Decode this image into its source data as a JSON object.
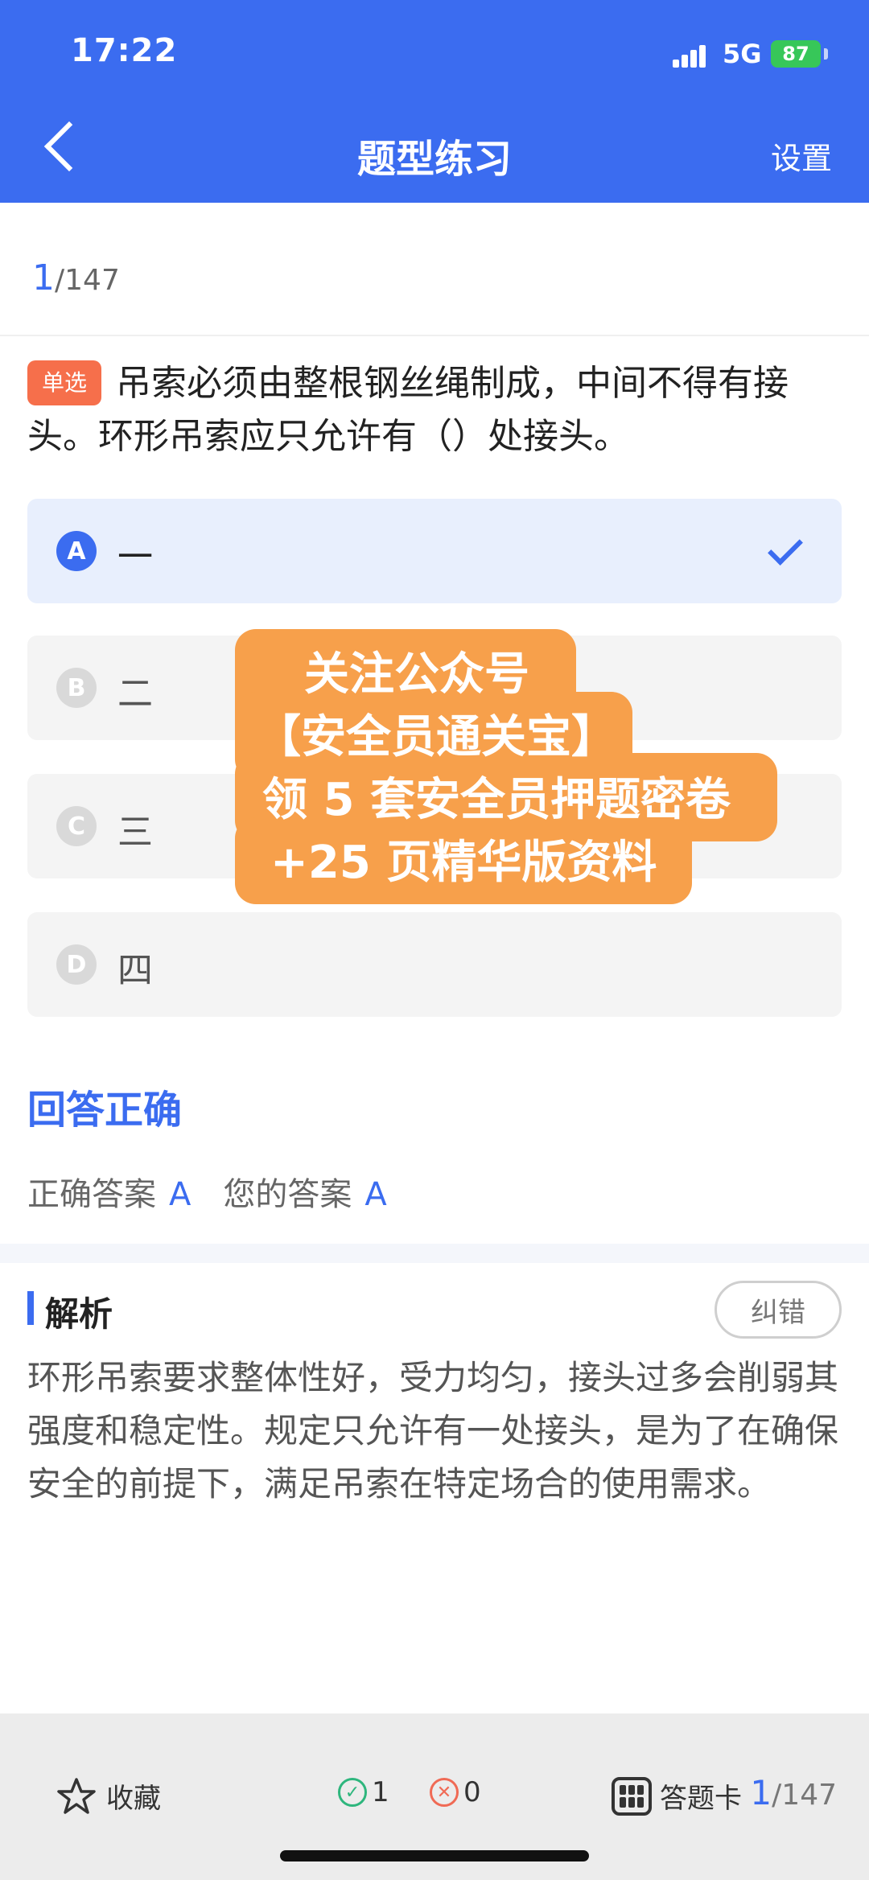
{
  "status_bar": {
    "time": "17:22",
    "network": "5G",
    "battery": "87"
  },
  "nav": {
    "title": "题型练习",
    "settings_label": "设置"
  },
  "progress": {
    "current": "1",
    "total": "/147"
  },
  "question": {
    "type_tag": "单选",
    "text": "吊索必须由整根钢丝绳制成，中间不得有接头。环形吊索应只允许有（）处接头。"
  },
  "options": [
    {
      "letter": "A",
      "text": "一",
      "selected": true
    },
    {
      "letter": "B",
      "text": "二",
      "selected": false
    },
    {
      "letter": "C",
      "text": "三",
      "selected": false
    },
    {
      "letter": "D",
      "text": "四",
      "selected": false
    }
  ],
  "promo": {
    "line1": "关注公众号",
    "line2": "【安全员通关宝】",
    "line3": "领 5 套安全员押题密卷",
    "line4": "+25 页精华版资料"
  },
  "result": {
    "status": "回答正确",
    "correct_label": "正确答案",
    "correct_value": "A",
    "your_label": "您的答案",
    "your_value": "A"
  },
  "analysis": {
    "title": "解析",
    "report_button": "纠错",
    "text": "环形吊索要求整体性好，受力均匀，接头过多会削弱其强度和稳定性。规定只允许有一处接头，是为了在确保安全的前提下，满足吊索在特定场合的使用需求。"
  },
  "bottom_bar": {
    "favorite_label": "收藏",
    "correct_count": "1",
    "wrong_count": "0",
    "answer_card_label": "答题卡",
    "progress_current": "1",
    "progress_total": "/147"
  },
  "colors": {
    "primary": "#3b6cf0",
    "tag": "#f66f4b",
    "promo": "#f7a04b",
    "correct": "#2eb67d",
    "wrong": "#f06a55"
  }
}
